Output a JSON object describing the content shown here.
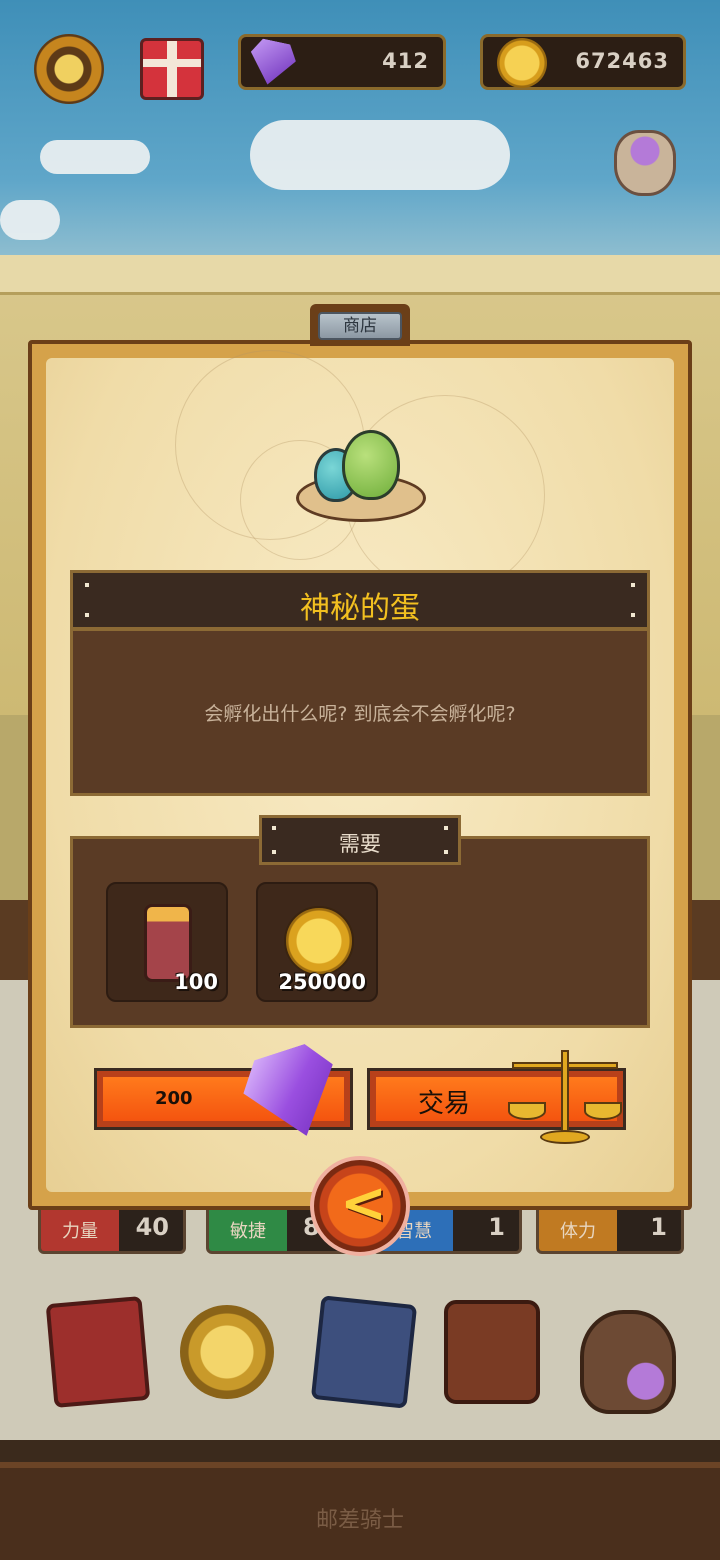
{
  "hud": {
    "settings_icon": "gear-icon",
    "gift_icon": "gift-box-icon",
    "gems": "412",
    "coins": "672463"
  },
  "shop": {
    "tab_label": "商店",
    "item": {
      "name": "神秘的蛋",
      "description": "会孵化出什么呢? 到底会不会孵化呢?"
    },
    "requirements_label": "需要",
    "requirements": [
      {
        "icon": "wood-log-icon",
        "amount": "100"
      },
      {
        "icon": "gold-coin-icon",
        "amount": "250000"
      }
    ],
    "gem_price": "200",
    "trade_label": "交易",
    "back_icon": "chevron-left-icon"
  },
  "stats": [
    {
      "label": "力量",
      "value": "40"
    },
    {
      "label": "敏捷",
      "value": "8"
    },
    {
      "label": "智慧",
      "value": "1"
    },
    {
      "label": "体力",
      "value": "1"
    }
  ],
  "footer": {
    "title": "邮差骑士"
  },
  "colors": {
    "title_text": "#f2c020",
    "button_orange": "#f4540f",
    "panel_parchment": "#f0dca8"
  }
}
